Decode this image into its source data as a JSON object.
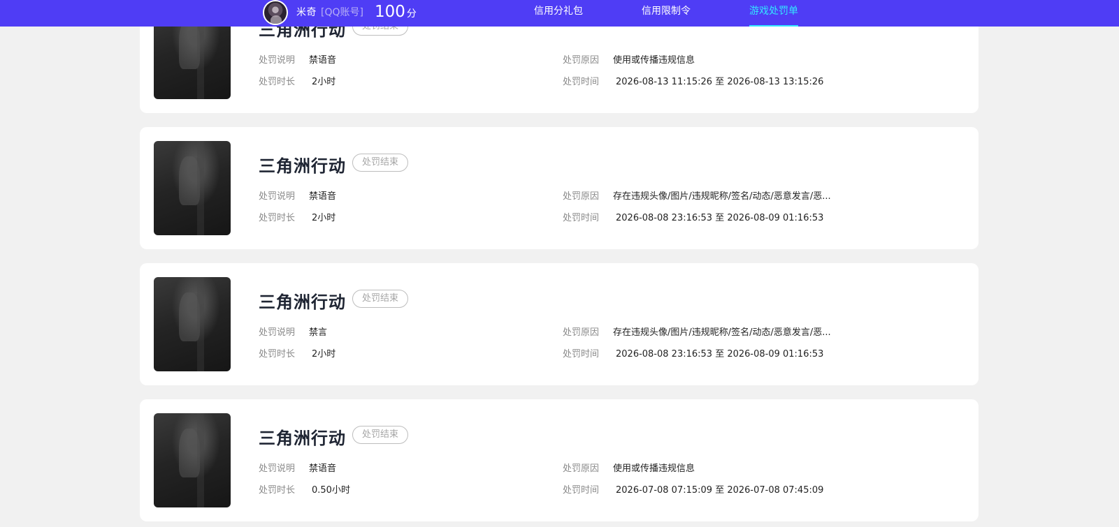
{
  "header": {
    "user_name": "米奇",
    "account_type": "[QQ账号]",
    "score_value": "100",
    "score_unit": "分",
    "tabs": [
      {
        "label": "信用分礼包",
        "active": false
      },
      {
        "label": "信用限制令",
        "active": false
      },
      {
        "label": "游戏处罚单",
        "active": true
      }
    ]
  },
  "labels": {
    "description": "处罚说明",
    "reason": "处罚原因",
    "duration": "处罚时长",
    "time": "处罚时间"
  },
  "records": [
    {
      "game": "三角洲行动",
      "status": "处罚结束",
      "description": "禁语音",
      "reason": "使用或传播违规信息",
      "duration": "2小时",
      "time": "2026-08-13 11:15:26 至 2026-08-13 13:15:26"
    },
    {
      "game": "三角洲行动",
      "status": "处罚结束",
      "description": "禁语音",
      "reason": "存在违规头像/图片/违规昵称/签名/动态/恶意发言/恶...",
      "duration": "2小时",
      "time": "2026-08-08 23:16:53 至 2026-08-09 01:16:53"
    },
    {
      "game": "三角洲行动",
      "status": "处罚结束",
      "description": "禁言",
      "reason": "存在违规头像/图片/违规昵称/签名/动态/恶意发言/恶...",
      "duration": "2小时",
      "time": "2026-08-08 23:16:53 至 2026-08-09 01:16:53"
    },
    {
      "game": "三角洲行动",
      "status": "处罚结束",
      "description": "禁语音",
      "reason": "使用或传播违规信息",
      "duration": "0.50小时",
      "time": "2026-07-08 07:15:09 至 2026-07-08 07:45:09"
    }
  ],
  "colors": {
    "nav_background": "#4f3df5",
    "active_tab": "#33e6ff",
    "page_background": "#f1f1f1"
  }
}
